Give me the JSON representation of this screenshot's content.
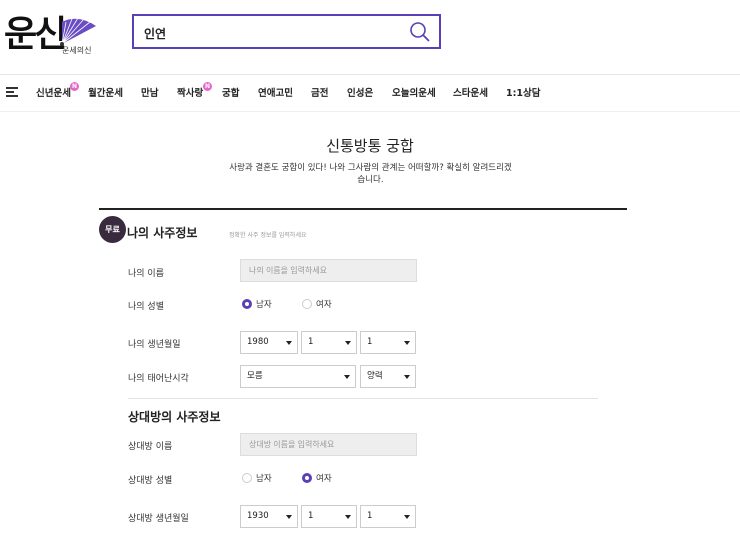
{
  "header": {
    "logo_text": "운신",
    "logo_sub": "운세의신",
    "search_value": "인연"
  },
  "nav": {
    "items": [
      {
        "label": "신년운세",
        "badge": "N"
      },
      {
        "label": "월간운세"
      },
      {
        "label": "만남"
      },
      {
        "label": "짝사랑",
        "badge": "N"
      },
      {
        "label": "궁합"
      },
      {
        "label": "연애고민"
      },
      {
        "label": "금전"
      },
      {
        "label": "인성은"
      },
      {
        "label": "오늘의운세"
      },
      {
        "label": "스타운세"
      },
      {
        "label": "1:1상담"
      }
    ]
  },
  "main": {
    "title": "신통방통 궁합",
    "description": "사랑과 결혼도 궁합이 있다! 나와 그사람의 관계는 어떠할까? 확실히 알려드리겠습니다.",
    "free_badge": "무료",
    "my_section": {
      "title": "나의 사주정보",
      "note": "정확한 사주 정보를 입력하세요",
      "name_label": "나의 이름",
      "name_placeholder": "나의 이름을 입력하세요",
      "gender_label": "나의 성별",
      "gender_male": "남자",
      "gender_female": "여자",
      "birth_label": "나의 생년월일",
      "birth_year": "1980",
      "birth_month": "1",
      "birth_day": "1",
      "time_label": "나의 태어난시각",
      "time_value": "모름",
      "calendar_value": "양력"
    },
    "partner_section": {
      "title": "상대방의 사주정보",
      "name_label": "상대방 이름",
      "name_placeholder": "상대방 이름을 입력하세요",
      "gender_label": "상대방 성별",
      "gender_male": "남자",
      "gender_female": "여자",
      "birth_label": "상대방 생년월일",
      "birth_year": "1930",
      "birth_month": "1",
      "birth_day": "1"
    }
  },
  "colors": {
    "accent": "#5a3fb8",
    "badge": "#e667c8",
    "free_badge": "#3a2a3e"
  }
}
